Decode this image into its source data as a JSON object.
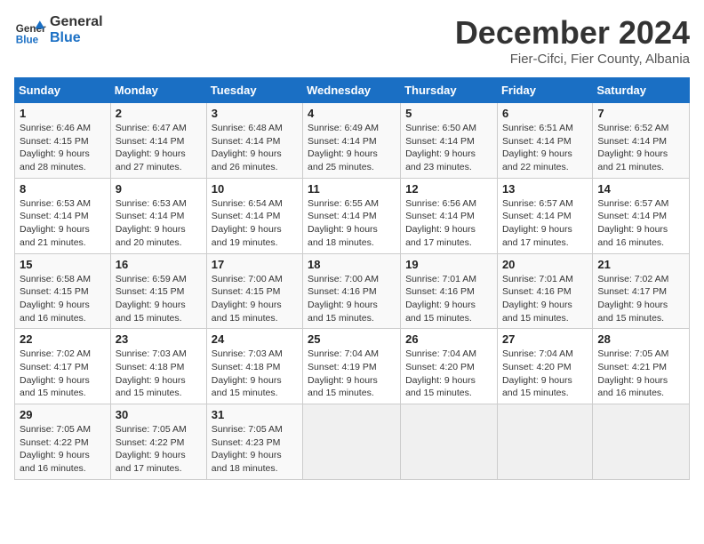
{
  "header": {
    "logo_general": "General",
    "logo_blue": "Blue",
    "month_title": "December 2024",
    "location": "Fier-Cifci, Fier County, Albania"
  },
  "days_of_week": [
    "Sunday",
    "Monday",
    "Tuesday",
    "Wednesday",
    "Thursday",
    "Friday",
    "Saturday"
  ],
  "weeks": [
    [
      {
        "day": "1",
        "info": "Sunrise: 6:46 AM\nSunset: 4:15 PM\nDaylight: 9 hours and 28 minutes."
      },
      {
        "day": "2",
        "info": "Sunrise: 6:47 AM\nSunset: 4:14 PM\nDaylight: 9 hours and 27 minutes."
      },
      {
        "day": "3",
        "info": "Sunrise: 6:48 AM\nSunset: 4:14 PM\nDaylight: 9 hours and 26 minutes."
      },
      {
        "day": "4",
        "info": "Sunrise: 6:49 AM\nSunset: 4:14 PM\nDaylight: 9 hours and 25 minutes."
      },
      {
        "day": "5",
        "info": "Sunrise: 6:50 AM\nSunset: 4:14 PM\nDaylight: 9 hours and 23 minutes."
      },
      {
        "day": "6",
        "info": "Sunrise: 6:51 AM\nSunset: 4:14 PM\nDaylight: 9 hours and 22 minutes."
      },
      {
        "day": "7",
        "info": "Sunrise: 6:52 AM\nSunset: 4:14 PM\nDaylight: 9 hours and 21 minutes."
      }
    ],
    [
      {
        "day": "8",
        "info": "Sunrise: 6:53 AM\nSunset: 4:14 PM\nDaylight: 9 hours and 21 minutes."
      },
      {
        "day": "9",
        "info": "Sunrise: 6:53 AM\nSunset: 4:14 PM\nDaylight: 9 hours and 20 minutes."
      },
      {
        "day": "10",
        "info": "Sunrise: 6:54 AM\nSunset: 4:14 PM\nDaylight: 9 hours and 19 minutes."
      },
      {
        "day": "11",
        "info": "Sunrise: 6:55 AM\nSunset: 4:14 PM\nDaylight: 9 hours and 18 minutes."
      },
      {
        "day": "12",
        "info": "Sunrise: 6:56 AM\nSunset: 4:14 PM\nDaylight: 9 hours and 17 minutes."
      },
      {
        "day": "13",
        "info": "Sunrise: 6:57 AM\nSunset: 4:14 PM\nDaylight: 9 hours and 17 minutes."
      },
      {
        "day": "14",
        "info": "Sunrise: 6:57 AM\nSunset: 4:14 PM\nDaylight: 9 hours and 16 minutes."
      }
    ],
    [
      {
        "day": "15",
        "info": "Sunrise: 6:58 AM\nSunset: 4:15 PM\nDaylight: 9 hours and 16 minutes."
      },
      {
        "day": "16",
        "info": "Sunrise: 6:59 AM\nSunset: 4:15 PM\nDaylight: 9 hours and 15 minutes."
      },
      {
        "day": "17",
        "info": "Sunrise: 7:00 AM\nSunset: 4:15 PM\nDaylight: 9 hours and 15 minutes."
      },
      {
        "day": "18",
        "info": "Sunrise: 7:00 AM\nSunset: 4:16 PM\nDaylight: 9 hours and 15 minutes."
      },
      {
        "day": "19",
        "info": "Sunrise: 7:01 AM\nSunset: 4:16 PM\nDaylight: 9 hours and 15 minutes."
      },
      {
        "day": "20",
        "info": "Sunrise: 7:01 AM\nSunset: 4:16 PM\nDaylight: 9 hours and 15 minutes."
      },
      {
        "day": "21",
        "info": "Sunrise: 7:02 AM\nSunset: 4:17 PM\nDaylight: 9 hours and 15 minutes."
      }
    ],
    [
      {
        "day": "22",
        "info": "Sunrise: 7:02 AM\nSunset: 4:17 PM\nDaylight: 9 hours and 15 minutes."
      },
      {
        "day": "23",
        "info": "Sunrise: 7:03 AM\nSunset: 4:18 PM\nDaylight: 9 hours and 15 minutes."
      },
      {
        "day": "24",
        "info": "Sunrise: 7:03 AM\nSunset: 4:18 PM\nDaylight: 9 hours and 15 minutes."
      },
      {
        "day": "25",
        "info": "Sunrise: 7:04 AM\nSunset: 4:19 PM\nDaylight: 9 hours and 15 minutes."
      },
      {
        "day": "26",
        "info": "Sunrise: 7:04 AM\nSunset: 4:20 PM\nDaylight: 9 hours and 15 minutes."
      },
      {
        "day": "27",
        "info": "Sunrise: 7:04 AM\nSunset: 4:20 PM\nDaylight: 9 hours and 15 minutes."
      },
      {
        "day": "28",
        "info": "Sunrise: 7:05 AM\nSunset: 4:21 PM\nDaylight: 9 hours and 16 minutes."
      }
    ],
    [
      {
        "day": "29",
        "info": "Sunrise: 7:05 AM\nSunset: 4:22 PM\nDaylight: 9 hours and 16 minutes."
      },
      {
        "day": "30",
        "info": "Sunrise: 7:05 AM\nSunset: 4:22 PM\nDaylight: 9 hours and 17 minutes."
      },
      {
        "day": "31",
        "info": "Sunrise: 7:05 AM\nSunset: 4:23 PM\nDaylight: 9 hours and 18 minutes."
      },
      {
        "day": "",
        "info": ""
      },
      {
        "day": "",
        "info": ""
      },
      {
        "day": "",
        "info": ""
      },
      {
        "day": "",
        "info": ""
      }
    ]
  ]
}
